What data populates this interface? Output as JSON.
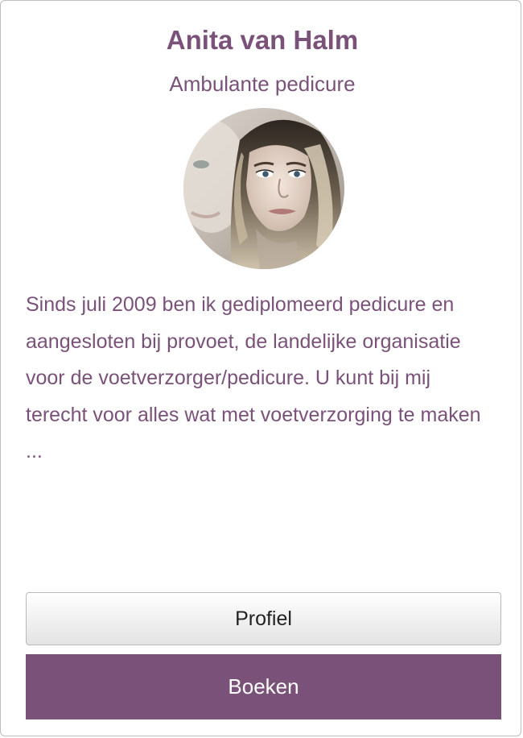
{
  "profile": {
    "name": "Anita van Halm",
    "role": "Ambulante pedicure",
    "description": "Sinds juli 2009 ben ik gediplomeerd pedicure en aangesloten bij provoet, de landelijke organisatie voor de voetverzorger/pedicure. U kunt bij mij terecht voor alles wat met voetverzorging te maken ..."
  },
  "buttons": {
    "profile_label": "Profiel",
    "book_label": "Boeken"
  },
  "colors": {
    "accent": "#7a5279",
    "button_text_dark": "#222222",
    "button_text_light": "#ffffff"
  }
}
